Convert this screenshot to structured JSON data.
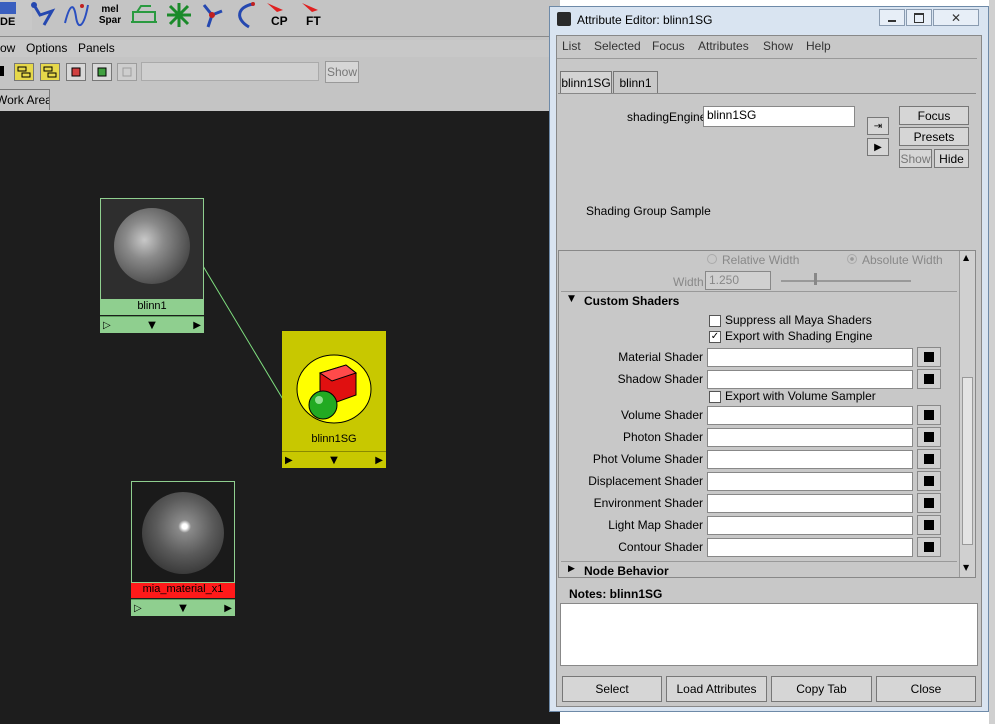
{
  "shelf": {
    "items": [
      {
        "label": "DE"
      },
      {
        "label": ""
      },
      {
        "label": ""
      },
      {
        "label": "mel Spar"
      },
      {
        "label": ""
      },
      {
        "label": ""
      },
      {
        "label": ""
      },
      {
        "label": ""
      },
      {
        "label": "CP"
      },
      {
        "label": "FT"
      }
    ]
  },
  "hypershade": {
    "menus": [
      "ow",
      "Options",
      "Panels"
    ],
    "filter_placeholder": "",
    "show_label": "Show",
    "work_tab": "Work Area",
    "nodes": {
      "blinn": "blinn1",
      "sg": "blinn1SG",
      "mia": "mia_material_x1"
    }
  },
  "attribute_editor": {
    "title": "Attribute Editor: blinn1SG",
    "menus": [
      "List",
      "Selected",
      "Focus",
      "Attributes",
      "Show",
      "Help"
    ],
    "tabs": [
      "blinn1SG",
      "blinn1"
    ],
    "shading_engine_label": "shadingEngine:",
    "shading_engine_value": "blinn1SG",
    "buttons": {
      "focus": "Focus",
      "presets": "Presets",
      "show": "Show",
      "hide": "Hide"
    },
    "sample_label": "Shading Group Sample",
    "relative_width": "Relative Width",
    "absolute_width": "Absolute Width",
    "width_label": "Width",
    "width_value": "1.250",
    "section_custom": "Custom Shaders",
    "suppress_label": "Suppress all Maya Shaders",
    "export_engine_label": "Export with Shading Engine",
    "export_volume_label": "Export with Volume Sampler",
    "shader_rows_a": [
      "Material Shader",
      "Shadow Shader"
    ],
    "shader_rows_b": [
      "Volume Shader",
      "Photon Shader",
      "Phot Volume Shader",
      "Displacement Shader",
      "Environment Shader",
      "Light Map Shader",
      "Contour Shader"
    ],
    "section_node": "Node Behavior",
    "notes_label": "Notes:  blinn1SG",
    "bottom_buttons": {
      "select": "Select",
      "load": "Load Attributes",
      "copy": "Copy Tab",
      "close": "Close"
    }
  },
  "colors": {
    "work_area": "#1d1d1d",
    "node_green": "#8fcf8f",
    "sg_yellow": "#c8c800",
    "mia_red": "#ff1a1a"
  }
}
